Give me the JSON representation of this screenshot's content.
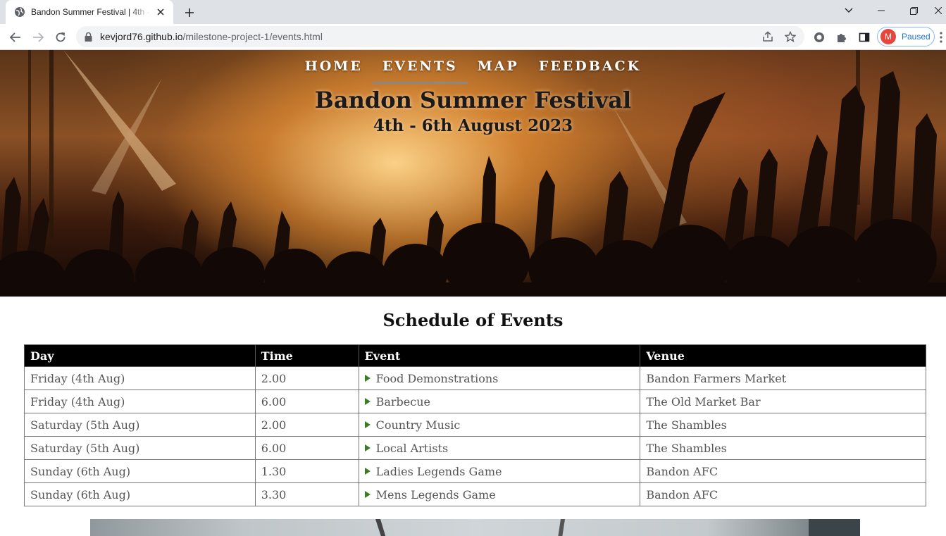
{
  "browser": {
    "tab_title": "Bandon Summer Festival | 4th - 6th August 2023",
    "url_host": "kevjord76.github.io",
    "url_path": "/milestone-project-1/events.html",
    "profile_initial": "M",
    "profile_status": "Paused"
  },
  "nav": {
    "items": [
      {
        "label": "HOME"
      },
      {
        "label": "EVENTS"
      },
      {
        "label": "MAP"
      },
      {
        "label": "FEEDBACK"
      }
    ],
    "active": "EVENTS"
  },
  "hero": {
    "title": "Bandon Summer Festival",
    "dates": "4th - 6th August 2023"
  },
  "schedule": {
    "heading": "Schedule of Events",
    "columns": [
      "Day",
      "Time",
      "Event",
      "Venue"
    ],
    "rows": [
      {
        "day": "Friday (4th Aug)",
        "time": "2.00",
        "event": "Food Demonstrations",
        "venue": "Bandon Farmers Market"
      },
      {
        "day": "Friday (4th Aug)",
        "time": "6.00",
        "event": "Barbecue",
        "venue": "The Old Market Bar"
      },
      {
        "day": "Saturday (5th Aug)",
        "time": "2.00",
        "event": "Country Music",
        "venue": "The Shambles"
      },
      {
        "day": "Saturday (5th Aug)",
        "time": "6.00",
        "event": "Local Artists",
        "venue": "The Shambles"
      },
      {
        "day": "Sunday (6th Aug)",
        "time": "1.30",
        "event": "Ladies Legends Game",
        "venue": "Bandon AFC"
      },
      {
        "day": "Sunday (6th Aug)",
        "time": "3.30",
        "event": "Mens Legends Game",
        "venue": "Bandon AFC"
      }
    ]
  },
  "colors": {
    "table_header_bg": "#000000",
    "event_arrow": "#3a7d24",
    "profile_accent": "#e8453c"
  }
}
